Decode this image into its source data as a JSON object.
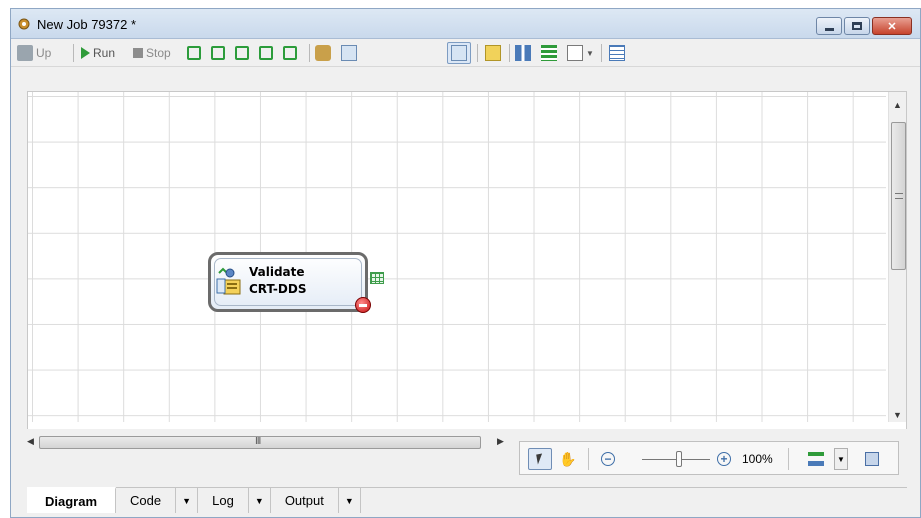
{
  "window": {
    "title": "New Job 79372 *"
  },
  "toolbar": {
    "up_label": "Up",
    "run_label": "Run",
    "stop_label": "Stop"
  },
  "node": {
    "title": "Validate",
    "subtitle": "CRT-DDS"
  },
  "zoom": {
    "level": "100%"
  },
  "hscroll": {
    "grip": "III"
  },
  "tabs": [
    {
      "label": "Diagram"
    },
    {
      "label": "Code"
    },
    {
      "label": "Log"
    },
    {
      "label": "Output"
    }
  ],
  "colors": {
    "accent": "#2f9b3a",
    "error": "#c41212"
  }
}
